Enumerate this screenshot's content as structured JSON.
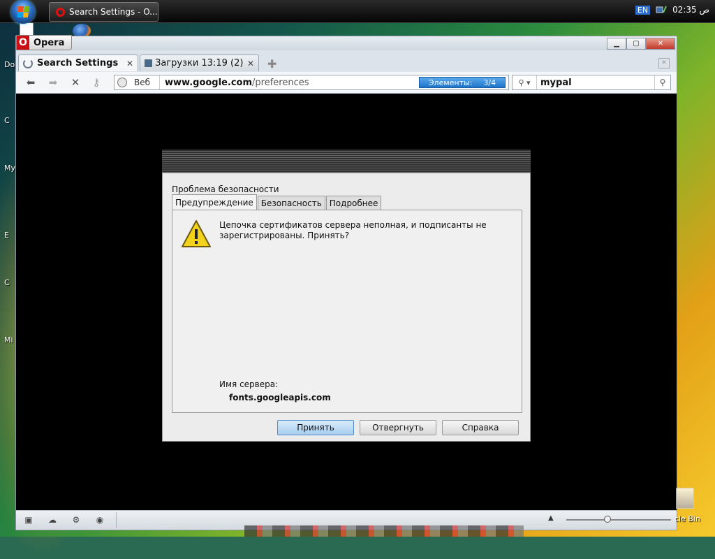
{
  "taskbar": {
    "task_title": "Search Settings - O...",
    "language": "EN",
    "clock": "02:35 ص"
  },
  "desktop": {
    "labels": [
      "Do",
      "C",
      "My",
      "E",
      "C",
      "Mi"
    ],
    "recycle_bin": "cle Bin"
  },
  "browser": {
    "menu_label": "Opera",
    "menu_icon": "opera-logo",
    "tabs": [
      {
        "label": "Search Settings",
        "active": true
      },
      {
        "label": "Загрузки 13:19 (2)",
        "active": false
      }
    ],
    "address": {
      "scheme_label": "Веб",
      "domain": "www.google.com",
      "path": "/preferences",
      "progress_label": "Элементы:",
      "progress_value": "3/4"
    },
    "search": {
      "value": "mypal"
    }
  },
  "dialog": {
    "title": "Проблема безопасности",
    "tabs": [
      "Предупреждение",
      "Безопасность",
      "Подробнее"
    ],
    "message": "Цепочка сертификатов сервера неполная, и подписанты не зарегистрированы. Принять?",
    "server_label": "Имя сервера:",
    "server_value": "fonts.googleapis.com",
    "buttons": {
      "accept": "Принять",
      "reject": "Отвергнуть",
      "help": "Справка"
    }
  },
  "colors": {
    "progress_blue": "#1f74c9",
    "opera_red": "#cc0f16",
    "warning_yellow": "#f2d21b"
  }
}
